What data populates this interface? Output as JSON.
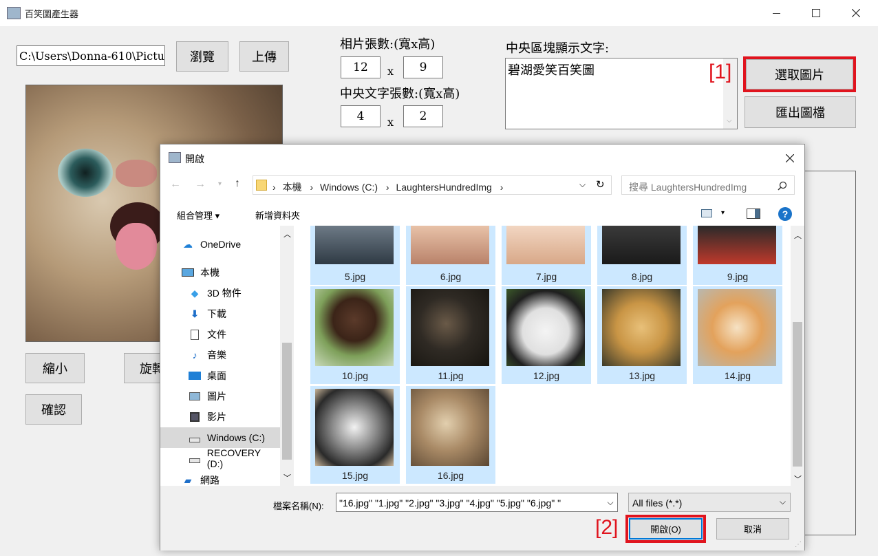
{
  "window": {
    "title": "百笑圖產生器"
  },
  "main": {
    "path_value": "C:\\Users\\Donna-610\\Pictur",
    "browse_label": "瀏覽",
    "upload_label": "上傳",
    "photo_count_label": "相片張數:(寬x高)",
    "photo_w": "12",
    "photo_h": "9",
    "times": "x",
    "center_count_label": "中央文字張數:(寬x高)",
    "center_w": "4",
    "center_h": "2",
    "center_text_label": "中央區塊顯示文字:",
    "center_text_value": "碧湖愛笑百笑圖",
    "select_label": "選取圖片",
    "export_label": "匯出圖檔",
    "shrink_label": "縮小",
    "rotate_label": "旋轉",
    "confirm_label": "確認",
    "annotation_1": "[1]",
    "annotation_2": "[2]"
  },
  "dialog": {
    "title": "開啟",
    "breadcrumb": [
      "本機",
      "Windows (C:)",
      "LaughtersHundredImg"
    ],
    "search_placeholder": "搜尋 LaughtersHundredImg",
    "organize_label": "組合管理 ▾",
    "new_folder_label": "新增資料夾",
    "sidebar": [
      {
        "label": "OneDrive",
        "icon": "cloud-icon"
      },
      {
        "label": "本機",
        "icon": "computer-icon"
      },
      {
        "label": "3D 物件",
        "icon": "cube-icon"
      },
      {
        "label": "下載",
        "icon": "download-icon"
      },
      {
        "label": "文件",
        "icon": "document-icon"
      },
      {
        "label": "音樂",
        "icon": "music-icon"
      },
      {
        "label": "桌面",
        "icon": "desktop-icon"
      },
      {
        "label": "圖片",
        "icon": "pictures-icon"
      },
      {
        "label": "影片",
        "icon": "video-icon"
      },
      {
        "label": "Windows (C:)",
        "icon": "drive-icon"
      },
      {
        "label": "RECOVERY (D:)",
        "icon": "drive-icon"
      },
      {
        "label": "網路",
        "icon": "network-icon"
      }
    ],
    "files": [
      "5.jpg",
      "6.jpg",
      "7.jpg",
      "8.jpg",
      "9.jpg",
      "10.jpg",
      "11.jpg",
      "12.jpg",
      "13.jpg",
      "14.jpg",
      "15.jpg",
      "16.jpg"
    ],
    "filename_label": "檔案名稱(N):",
    "filename_value": "\"16.jpg\" \"1.jpg\" \"2.jpg\" \"3.jpg\" \"4.jpg\" \"5.jpg\" \"6.jpg\" \"",
    "filetype_value": "All files (*.*)",
    "open_label": "開啟(O)",
    "cancel_label": "取消"
  },
  "colors": {
    "selection": "#cce8ff",
    "annotation": "#e0141e",
    "accent": "#0078d7"
  }
}
